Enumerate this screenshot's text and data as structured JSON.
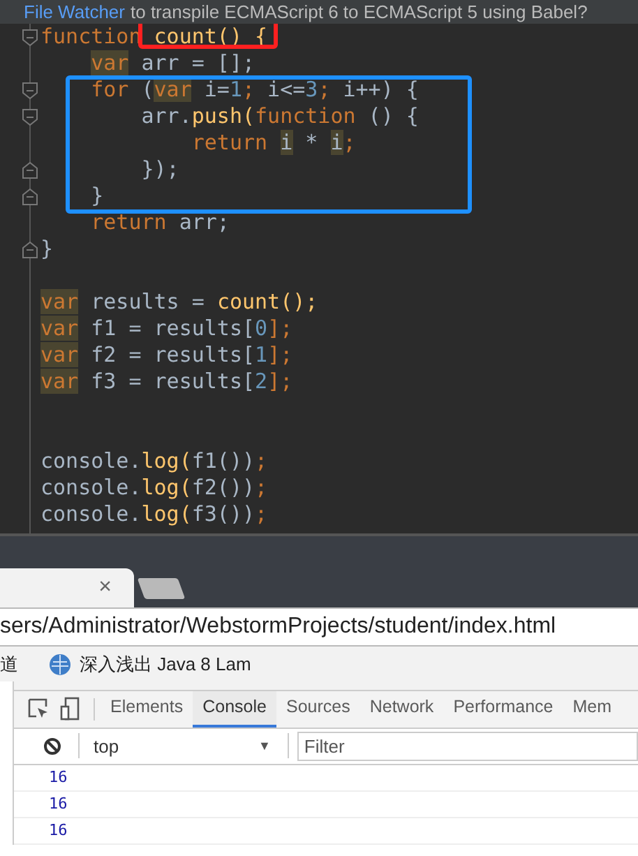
{
  "notification": {
    "link": "File Watcher",
    "text": "to transpile ECMAScript 6 to ECMAScript 5 using Babel?"
  },
  "editor": {
    "blocks": [
      {
        "lines": [
          {
            "kind": "fold-start",
            "tokens": [
              {
                "text": "function",
                "kind": "keyword"
              },
              {
                "text": " count() {",
                "kind": "call",
                "color": "#ff2020"
              }
            ]
          },
          {
            "kind": "code",
            "tokens": [
              {
                "text": "    var",
                "kind": "keyword-marked"
              },
              {
                "text": " arr = [];",
                "kind": "plain"
              }
            ]
          }
        ]
      },
      {
        "color": "#1e90ff",
        "lines": [
          {
            "kind": "fold-start",
            "tokens": [
              {
                "text": "    for",
                "kind": "keyword"
              },
              {
                "text": " (",
                "kind": "plain"
              },
              {
                "text": "var",
                "kind": "keyword-marked"
              },
              {
                "text": " i=",
                "kind": "plain"
              },
              {
                "text": "1",
                "kind": "number"
              },
              {
                "text": ";",
                "kind": "keyword"
              },
              {
                "text": " i<=",
                "kind": "plain"
              },
              {
                "text": "3",
                "kind": "number"
              },
              {
                "text": ";",
                "kind": "keyword"
              },
              {
                "text": " i++) {",
                "kind": "plain"
              }
            ]
          },
          {
            "kind": "fold-start",
            "tokens": [
              {
                "text": "        arr.",
                "kind": "plain"
              },
              {
                "text": "push(",
                "kind": "call"
              },
              {
                "text": "function",
                "kind": "keyword"
              },
              {
                "text": " () {",
                "kind": "plain"
              }
            ]
          },
          {
            "kind": "code",
            "tokens": [
              {
                "text": "            return ",
                "kind": "keyword"
              },
              {
                "text": "i",
                "kind": "plain-marked"
              },
              {
                "text": " * ",
                "kind": "plain"
              },
              {
                "text": "i",
                "kind": "plain-marked"
              },
              {
                "text": ";",
                "kind": "keyword"
              }
            ]
          },
          {
            "kind": "fold-end",
            "tokens": [
              {
                "text": "        });",
                "kind": "plain"
              }
            ]
          },
          {
            "kind": "fold-end",
            "tokens": [
              {
                "text": "    }",
                "kind": "plain"
              }
            ]
          }
        ]
      },
      {
        "lines": [
          {
            "kind": "code",
            "tokens": [
              {
                "text": "    return",
                "kind": "keyword"
              },
              {
                "text": " arr;",
                "kind": "plain"
              }
            ]
          },
          {
            "kind": "fold-end",
            "tokens": [
              {
                "text": "}",
                "kind": "plain"
              }
            ]
          },
          {
            "kind": "blank"
          },
          {
            "kind": "code",
            "tokens": [
              {
                "text": "var",
                "kind": "keyword-marked"
              },
              {
                "text": " results = ",
                "kind": "plain"
              },
              {
                "text": "count();",
                "kind": "call"
              }
            ]
          },
          {
            "kind": "code",
            "tokens": [
              {
                "text": "var",
                "kind": "keyword-marked"
              },
              {
                "text": " f1 = results[",
                "kind": "plain"
              },
              {
                "text": "0",
                "kind": "number"
              },
              {
                "text": "];",
                "kind": "keyword"
              }
            ]
          },
          {
            "kind": "code",
            "tokens": [
              {
                "text": "var",
                "kind": "keyword-marked"
              },
              {
                "text": " f2 = results[",
                "kind": "plain"
              },
              {
                "text": "1",
                "kind": "number"
              },
              {
                "text": "];",
                "kind": "keyword"
              }
            ]
          },
          {
            "kind": "code",
            "tokens": [
              {
                "text": "var",
                "kind": "keyword-marked"
              },
              {
                "text": " f3 = results[",
                "kind": "plain"
              },
              {
                "text": "2",
                "kind": "number"
              },
              {
                "text": "];",
                "kind": "keyword"
              }
            ]
          },
          {
            "kind": "blank"
          },
          {
            "kind": "blank"
          },
          {
            "kind": "code",
            "tokens": [
              {
                "text": "console.",
                "kind": "plain"
              },
              {
                "text": "log(",
                "kind": "call"
              },
              {
                "text": "f1())",
                "kind": "plain"
              },
              {
                "text": ";",
                "kind": "keyword"
              }
            ]
          },
          {
            "kind": "code",
            "tokens": [
              {
                "text": "console.",
                "kind": "plain"
              },
              {
                "text": "log(",
                "kind": "call"
              },
              {
                "text": "f2())",
                "kind": "plain"
              },
              {
                "text": ";",
                "kind": "keyword"
              }
            ]
          },
          {
            "kind": "code",
            "tokens": [
              {
                "text": "console.",
                "kind": "plain"
              },
              {
                "text": "log(",
                "kind": "call"
              },
              {
                "text": "f3())",
                "kind": "plain"
              },
              {
                "text": ";",
                "kind": "keyword"
              }
            ]
          }
        ]
      }
    ]
  },
  "browser": {
    "tab": {
      "close": "×"
    },
    "address": "sers/Administrator/WebstormProjects/student/index.html",
    "bookmarks": [
      {
        "label": "道",
        "kind": "text"
      },
      {
        "label": "深入浅出 Java 8 Lam",
        "kind": "site"
      }
    ]
  },
  "devtools": {
    "tabs": [
      {
        "label": "Elements",
        "selected": false
      },
      {
        "label": "Console",
        "selected": true
      },
      {
        "label": "Sources",
        "selected": false
      },
      {
        "label": "Network",
        "selected": false
      },
      {
        "label": "Performance",
        "selected": false
      },
      {
        "label": "Mem",
        "selected": false
      }
    ],
    "context": "top",
    "context_caret": "▼",
    "filter": {
      "placeholder": "Filter"
    },
    "messages": [
      "16",
      "16",
      "16"
    ]
  }
}
